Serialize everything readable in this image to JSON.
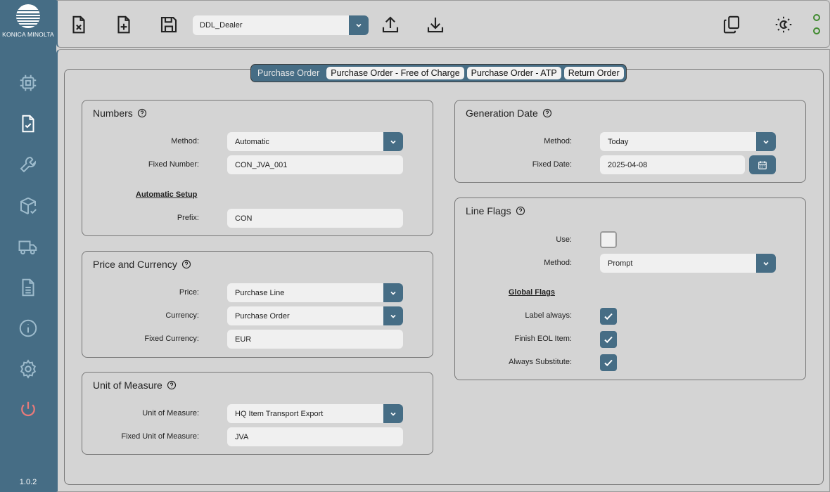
{
  "brand": {
    "name": "KONICA MINOLTA",
    "version": "1.0.2"
  },
  "sidebar": {
    "items": [
      {
        "icon": "chip-icon"
      },
      {
        "icon": "document-check-icon"
      },
      {
        "icon": "wrench-icon"
      },
      {
        "icon": "box-check-icon"
      },
      {
        "icon": "truck-icon"
      },
      {
        "icon": "document-lines-icon"
      },
      {
        "icon": "info-icon"
      },
      {
        "icon": "gear-icon"
      },
      {
        "icon": "power-icon"
      }
    ]
  },
  "toolbar": {
    "config_value": "DDL_Dealer",
    "buttons": [
      "close-file-icon",
      "new-file-icon",
      "save-icon",
      "upload-icon",
      "download-icon",
      "copy-icon",
      "theme-toggle-icon"
    ],
    "status_color": "#3f8a2e"
  },
  "tabs": [
    {
      "label": "Purchase Order",
      "active": true
    },
    {
      "label": "Purchase Order - Free of Charge",
      "active": false
    },
    {
      "label": "Purchase Order - ATP",
      "active": false
    },
    {
      "label": "Return Order",
      "active": false
    }
  ],
  "numbers": {
    "title": "Numbers",
    "method_label": "Method:",
    "method_value": "Automatic",
    "fixed_label": "Fixed Number:",
    "fixed_value": "CON_JVA_001",
    "auto_setup": "Automatic Setup",
    "prefix_label": "Prefix:",
    "prefix_value": "CON"
  },
  "price": {
    "title": "Price and Currency",
    "price_label": "Price:",
    "price_value": "Purchase Line",
    "currency_label": "Currency:",
    "currency_value": "Purchase Order",
    "fixed_label": "Fixed Currency:",
    "fixed_value": "EUR"
  },
  "uom": {
    "title": "Unit of Measure",
    "uom_label": "Unit of Measure:",
    "uom_value": "HQ Item Transport Export",
    "fixed_label": "Fixed Unit of Measure:",
    "fixed_value": "JVA"
  },
  "gendate": {
    "title": "Generation Date",
    "method_label": "Method:",
    "method_value": "Today",
    "fixed_label": "Fixed Date:",
    "fixed_value": "2025-04-08"
  },
  "lineflags": {
    "title": "Line Flags",
    "use_label": "Use:",
    "use_checked": false,
    "method_label": "Method:",
    "method_value": "Prompt",
    "global_head": "Global Flags",
    "label_always": "Label always:",
    "label_always_checked": true,
    "finish_eol": "Finish EOL Item:",
    "finish_eol_checked": true,
    "always_sub": "Always Substitute:",
    "always_sub_checked": true
  },
  "colors": {
    "accent": "#466d85",
    "panel": "#d4d4d4",
    "field": "#f0f0f0",
    "power": "#e87a7a"
  }
}
